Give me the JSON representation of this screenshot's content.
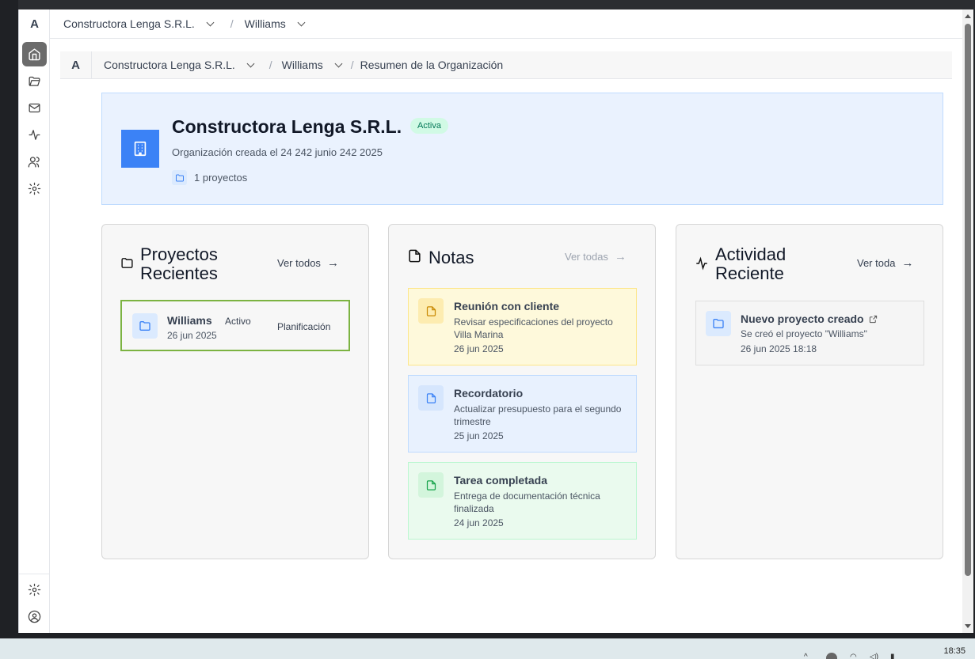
{
  "top_breadcrumb": {
    "org": "Constructora Lenga S.R.L.",
    "project": "Williams",
    "separator": "/"
  },
  "sidebar": {
    "logo": "A",
    "items": [
      "home-icon",
      "folder-icon",
      "mail-icon",
      "activity-icon",
      "users-icon",
      "settings-icon"
    ],
    "bottom": [
      "settings-icon",
      "user-circle-icon"
    ]
  },
  "inner_breadcrumb": {
    "logo": "A",
    "org": "Constructora Lenga S.R.L.",
    "project": "Williams",
    "page": "Resumen de la Organización",
    "separator": "/"
  },
  "organization": {
    "name": "Constructora Lenga S.R.L.",
    "status": "Activa",
    "created": "Organización creada el 24 242 junio 242 2025",
    "projects_count": "1 proyectos"
  },
  "projects_card": {
    "title": "Proyectos Recientes",
    "view_all": "Ver todos",
    "items": [
      {
        "name": "Williams",
        "status": "Activo",
        "phase": "Planificación",
        "date": "26 jun 2025"
      }
    ]
  },
  "notes_card": {
    "title": "Notas",
    "view_all": "Ver todas",
    "items": [
      {
        "title": "Reunión con cliente",
        "body": "Revisar especificaciones del proyecto Villa Marina",
        "date": "26 jun 2025",
        "color": "#fef9c3"
      },
      {
        "title": "Recordatorio",
        "body": "Actualizar presupuesto para el segundo trimestre",
        "date": "25 jun 2025",
        "color": "#e8f1fe"
      },
      {
        "title": "Tarea completada",
        "body": "Entrega de documentación técnica finalizada",
        "date": "24 jun 2025",
        "color": "#eafaee"
      }
    ]
  },
  "activity_card": {
    "title": "Actividad Reciente",
    "view_all": "Ver toda",
    "items": [
      {
        "title": "Nuevo proyecto creado",
        "body": "Se creó el proyecto \"Williams\"",
        "date": "26 jun 2025 18:18"
      }
    ]
  },
  "taskbar": {
    "clock": "18:35"
  },
  "colors": {
    "accent": "#3b82f6",
    "active_badge": "#d1fae5",
    "selected_border": "#7cb342"
  }
}
